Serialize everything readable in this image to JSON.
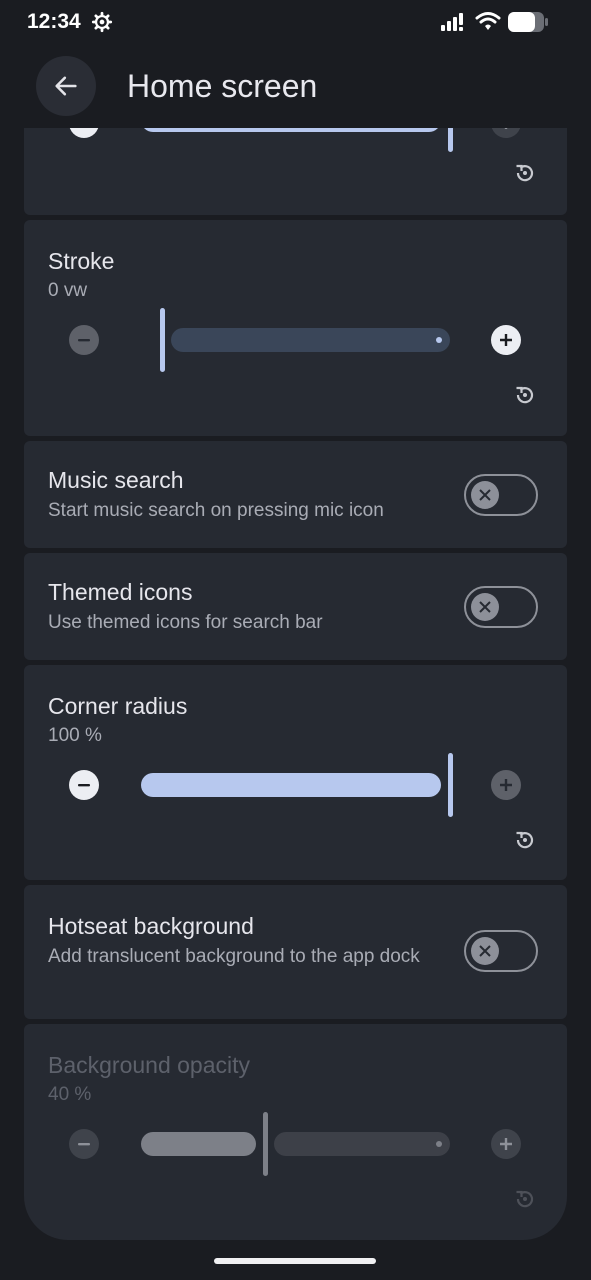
{
  "status_bar": {
    "time": "12:34",
    "battery_level": 0.75
  },
  "header": {
    "title": "Home screen"
  },
  "colors": {
    "accent": "#b7c8ee",
    "card": "#262a32",
    "background": "#1a1c21"
  },
  "settings": {
    "partial_top": {
      "slider_value": 1.0
    },
    "stroke": {
      "title": "Stroke",
      "value": "0 vw",
      "slider_value": 0.0
    },
    "music_search": {
      "title": "Music search",
      "subtitle": "Start music search on pressing mic icon",
      "enabled": false
    },
    "themed_icons": {
      "title": "Themed icons",
      "subtitle": "Use themed icons for search bar",
      "enabled": false
    },
    "corner_radius": {
      "title": "Corner radius",
      "value": "100 %",
      "slider_value": 1.0
    },
    "hotseat_background": {
      "title": "Hotseat background",
      "subtitle": "Add translucent background to the app dock",
      "enabled": false
    },
    "background_opacity": {
      "title": "Background opacity",
      "value": "40 %",
      "slider_value": 0.4,
      "disabled": true
    }
  },
  "icons": [
    "settings-gear-icon",
    "signal-icon",
    "wifi-icon",
    "battery-icon",
    "back-arrow-icon",
    "minus-icon",
    "plus-icon",
    "reset-icon",
    "close-icon"
  ]
}
